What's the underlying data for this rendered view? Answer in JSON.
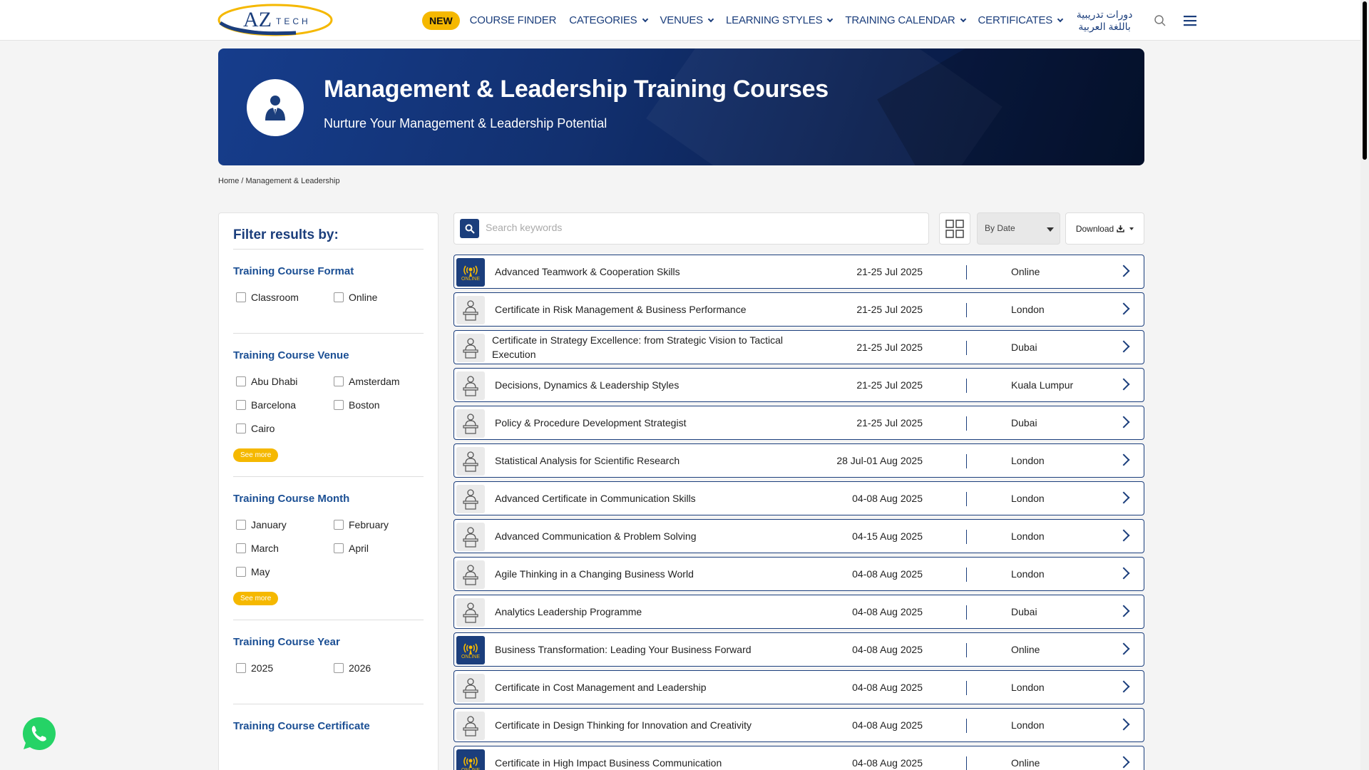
{
  "header": {
    "logo_text": "AZ",
    "logo_sub": "TECH",
    "nav_new": "NEW",
    "nav": [
      {
        "label": "COURSE FINDER",
        "dropdown": false
      },
      {
        "label": "CATEGORIES",
        "dropdown": true
      },
      {
        "label": "VENUES",
        "dropdown": true
      },
      {
        "label": "LEARNING STYLES",
        "dropdown": true
      },
      {
        "label": "TRAINING CALENDAR",
        "dropdown": true
      },
      {
        "label": "CERTIFICATES",
        "dropdown": true
      }
    ],
    "arabic_line1": "دورات تدريبية",
    "arabic_line2": "باللغة العربية"
  },
  "banner": {
    "title": "Management & Leadership Training Courses",
    "subtitle": "Nurture Your Management & Leadership Potential"
  },
  "breadcrumb": "Home / Management & Leadership",
  "filters": {
    "title": "Filter results by:",
    "see_more": "See more",
    "format": {
      "title": "Training Course Format",
      "options": [
        "Classroom",
        "Online"
      ]
    },
    "venue": {
      "title": "Training Course Venue",
      "options": [
        "Abu Dhabi",
        "Amsterdam",
        "Barcelona",
        "Boston",
        "Cairo"
      ]
    },
    "month": {
      "title": "Training Course Month",
      "options": [
        "January",
        "February",
        "March",
        "April",
        "May"
      ]
    },
    "year": {
      "title": "Training Course Year",
      "options": [
        "2025",
        "2026"
      ]
    },
    "certificate": {
      "title": "Training Course Certificate"
    }
  },
  "toolbar": {
    "search_placeholder": "Search keywords",
    "sort_value": "By Date",
    "download_label": "Download"
  },
  "courses": [
    {
      "title": "Advanced Teamwork & Cooperation Skills",
      "date": "21-25 Jul 2025",
      "venue": "Online",
      "type": "online"
    },
    {
      "title": "Certificate in Risk Management & Business Performance",
      "date": "21-25 Jul 2025",
      "venue": "London",
      "type": "classroom"
    },
    {
      "title": "Certificate in Strategy Excellence: from Strategic Vision to Tactical Execution",
      "date": "21-25 Jul 2025",
      "venue": "Dubai",
      "type": "classroom"
    },
    {
      "title": "Decisions, Dynamics & Leadership Styles",
      "date": "21-25 Jul 2025",
      "venue": "Kuala Lumpur",
      "type": "classroom"
    },
    {
      "title": "Policy & Procedure Development Strategist",
      "date": "21-25 Jul 2025",
      "venue": "Dubai",
      "type": "classroom"
    },
    {
      "title": "Statistical Analysis for Scientific Research",
      "date": "28 Jul-01 Aug 2025",
      "venue": "London",
      "type": "classroom"
    },
    {
      "title": "Advanced Certificate in Communication Skills",
      "date": "04-08 Aug 2025",
      "venue": "London",
      "type": "classroom"
    },
    {
      "title": "Advanced Communication & Problem Solving",
      "date": "04-15 Aug 2025",
      "venue": "London",
      "type": "classroom"
    },
    {
      "title": "Agile Thinking in a Changing Business World",
      "date": "04-08 Aug 2025",
      "venue": "London",
      "type": "classroom"
    },
    {
      "title": "Analytics Leadership Programme",
      "date": "04-08 Aug 2025",
      "venue": "Dubai",
      "type": "classroom"
    },
    {
      "title": "Business Transformation: Leading Your Business Forward",
      "date": "04-08 Aug 2025",
      "venue": "Online",
      "type": "online"
    },
    {
      "title": "Certificate in Cost Management and Leadership",
      "date": "04-08 Aug 2025",
      "venue": "London",
      "type": "classroom"
    },
    {
      "title": "Certificate in Design Thinking for Innovation and Creativity",
      "date": "04-08 Aug 2025",
      "venue": "London",
      "type": "classroom"
    },
    {
      "title": "Certificate in High Impact Business Communication",
      "date": "04-08 Aug 2025",
      "venue": "Online",
      "type": "online"
    }
  ],
  "online_badge": "ONLINE",
  "colors": {
    "brand_blue": "#1b3e7c",
    "accent_yellow": "#f5b800",
    "whatsapp_green": "#25d366"
  }
}
